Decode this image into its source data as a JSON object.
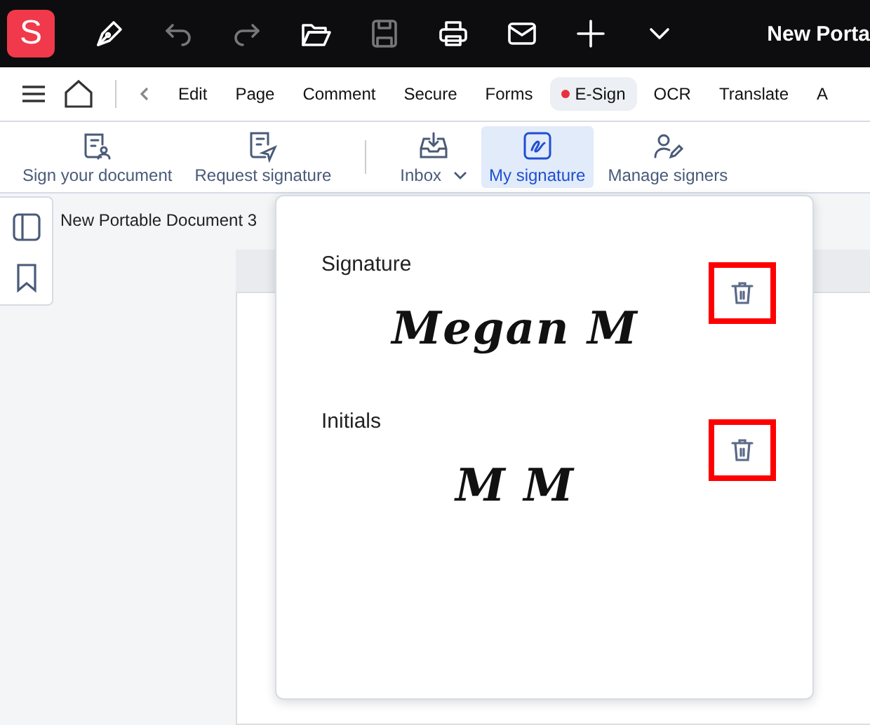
{
  "app_bar": {
    "logo": "S",
    "title": "New Porta",
    "tools": [
      {
        "kind": "pen",
        "disabled": false
      },
      {
        "kind": "undo",
        "disabled": true
      },
      {
        "kind": "redo",
        "disabled": true
      },
      {
        "kind": "folder",
        "disabled": false
      },
      {
        "kind": "save",
        "disabled": true
      },
      {
        "kind": "print",
        "disabled": false
      },
      {
        "kind": "mail",
        "disabled": false
      },
      {
        "kind": "plus",
        "disabled": false
      },
      {
        "kind": "chevron",
        "disabled": false
      }
    ]
  },
  "tabs": [
    {
      "label": "Edit",
      "selected": false,
      "dot": false
    },
    {
      "label": "Page",
      "selected": false,
      "dot": false
    },
    {
      "label": "Comment",
      "selected": false,
      "dot": false
    },
    {
      "label": "Secure",
      "selected": false,
      "dot": false
    },
    {
      "label": "Forms",
      "selected": false,
      "dot": false
    },
    {
      "label": "E-Sign",
      "selected": true,
      "dot": true
    },
    {
      "label": "OCR",
      "selected": false,
      "dot": false
    },
    {
      "label": "Translate",
      "selected": false,
      "dot": false
    },
    {
      "label": "A",
      "selected": false,
      "dot": false
    }
  ],
  "ribbon": [
    {
      "kind": "sign",
      "label": "Sign your document",
      "selected": false,
      "dropdown": false
    },
    {
      "kind": "request",
      "label": "Request signature",
      "selected": false,
      "dropdown": false
    },
    {
      "kind": "inbox",
      "label": "Inbox",
      "selected": false,
      "dropdown": true
    },
    {
      "kind": "mysig",
      "label": "My signature",
      "selected": true,
      "dropdown": false
    },
    {
      "kind": "signers",
      "label": "Manage signers",
      "selected": false,
      "dropdown": false
    }
  ],
  "document": {
    "title": "New Portable Document 3"
  },
  "signature_panel": {
    "entries": [
      {
        "heading": "Signature",
        "signature": "Megan M",
        "highlighted": true
      },
      {
        "heading": "Initials",
        "signature": "M M",
        "highlighted": true
      }
    ]
  }
}
